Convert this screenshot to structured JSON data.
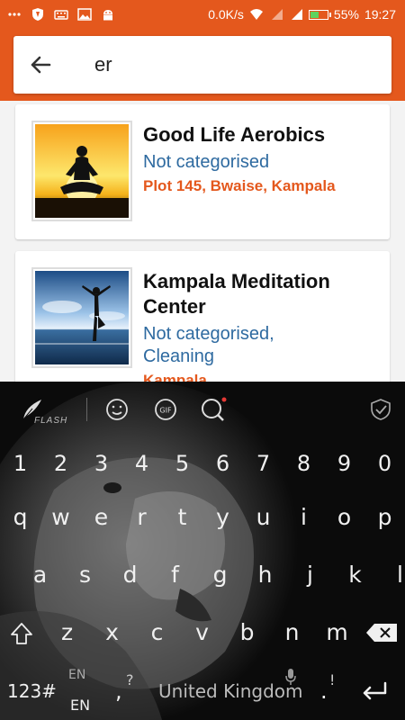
{
  "status_bar": {
    "left_icons": [
      "dots-icon",
      "shield-app-icon",
      "keyboard-icon",
      "image-icon",
      "android-icon"
    ],
    "network_speed": "0.0K/s",
    "battery_percent": "55%",
    "battery_level": 0.55,
    "time": "19:27"
  },
  "search": {
    "query": "er"
  },
  "results": [
    {
      "title": "Good Life Aerobics",
      "category": "Not categorised",
      "address": "Plot 145, Bwaise, Kampala",
      "thumb": "yoga-sunset-image"
    },
    {
      "title_line1": "Kampala Meditation",
      "title_line2": "Center",
      "category_line1": "Not categorised,",
      "category_line2": "Cleaning",
      "address": "Kampala",
      "thumb": "yoga-beach-image"
    }
  ],
  "keyboard": {
    "flash_label": "FLASH",
    "number_row": [
      "1",
      "2",
      "3",
      "4",
      "5",
      "6",
      "7",
      "8",
      "9",
      "0"
    ],
    "row1": [
      "q",
      "w",
      "e",
      "r",
      "t",
      "y",
      "u",
      "i",
      "o",
      "p"
    ],
    "row2": [
      "a",
      "s",
      "d",
      "f",
      "g",
      "h",
      "j",
      "k",
      "l"
    ],
    "row3": [
      "z",
      "x",
      "c",
      "v",
      "b",
      "n",
      "m"
    ],
    "numbers_key": "123#",
    "lang_top": "EN",
    "lang_bottom": "EN",
    "comma_key": ",",
    "question_key": "?",
    "space_label": "United Kingdom",
    "period_key": ".",
    "exclaim_key": "!",
    "colors": {
      "accent": "#e4581d",
      "link_blue": "#2e6aa0"
    }
  }
}
